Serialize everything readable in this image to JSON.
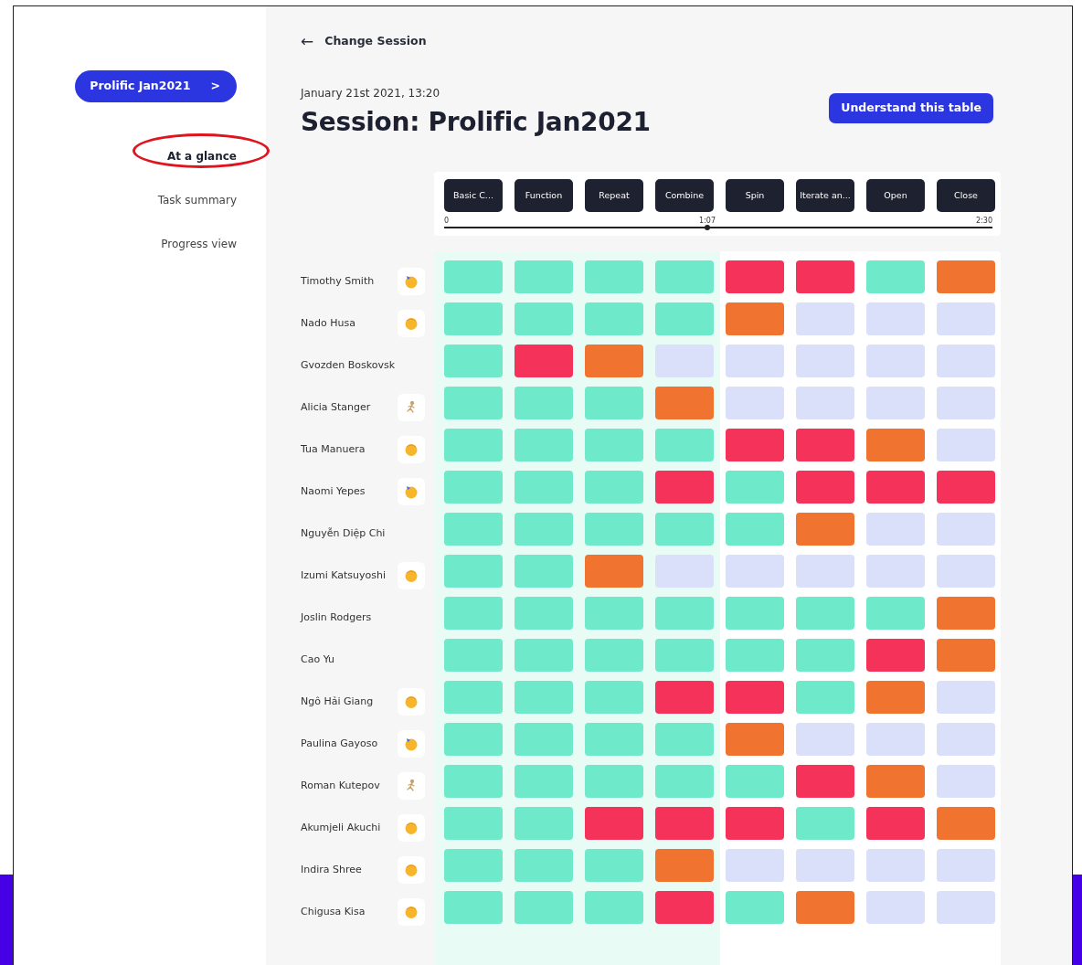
{
  "session_button": {
    "label": "Prolific Jan2021",
    "chevron": ">"
  },
  "sidebar": {
    "items": [
      {
        "label": "At a glance",
        "selected": true,
        "circled": true
      },
      {
        "label": "Task summary",
        "selected": false,
        "circled": false
      },
      {
        "label": "Progress view",
        "selected": false,
        "circled": false
      }
    ]
  },
  "back_link": {
    "arrow": "←",
    "label": "Change Session"
  },
  "date": "January 21st 2021, 13:20",
  "title": "Session: Prolific Jan2021",
  "help_button": "Understand this table",
  "tasks": [
    {
      "label": "Basic C...",
      "highlighted": true
    },
    {
      "label": "Function",
      "highlighted": true
    },
    {
      "label": "Repeat",
      "highlighted": true
    },
    {
      "label": "Combine",
      "highlighted": true
    },
    {
      "label": "Spin",
      "highlighted": false
    },
    {
      "label": "Iterate an...",
      "highlighted": false
    },
    {
      "label": "Open",
      "highlighted": false
    },
    {
      "label": "Close",
      "highlighted": false
    }
  ],
  "timeline": {
    "start": "0",
    "marker": "1:07",
    "end": "2:30",
    "level": 0.48
  },
  "students": [
    {
      "name": "Timothy Smith",
      "kind": "party",
      "results": [
        {
          "color": "#6ee9c9"
        },
        {
          "color": "#6ee9c9"
        },
        {
          "color": "#6ee9c9"
        },
        {
          "color": "#6ee9c9"
        },
        {
          "color": "#f5335a"
        },
        {
          "color": "#f5335a"
        },
        {
          "color": "#6ee9c9"
        },
        {
          "color": "#f0742f"
        }
      ]
    },
    {
      "name": "Nado Husa",
      "kind": "sleepy",
      "results": [
        {
          "color": "#6ee9c9"
        },
        {
          "color": "#6ee9c9"
        },
        {
          "color": "#6ee9c9"
        },
        {
          "color": "#6ee9c9"
        },
        {
          "color": "#f0742f"
        },
        {
          "color": "#dadffa"
        },
        {
          "color": "#dadffa"
        },
        {
          "color": "#dadffa"
        }
      ]
    },
    {
      "name": "Gvozden Boskovsk",
      "kind": "plain",
      "results": [
        {
          "color": "#6ee9c9"
        },
        {
          "color": "#f5335a"
        },
        {
          "color": "#f0742f"
        },
        {
          "color": "#dadffa"
        },
        {
          "color": "#dadffa"
        },
        {
          "color": "#dadffa"
        },
        {
          "color": "#dadffa"
        },
        {
          "color": "#dadffa"
        }
      ]
    },
    {
      "name": "Alicia Stanger",
      "kind": "runner",
      "results": [
        {
          "color": "#6ee9c9"
        },
        {
          "color": "#6ee9c9"
        },
        {
          "color": "#6ee9c9"
        },
        {
          "color": "#f0742f"
        },
        {
          "color": "#dadffa"
        },
        {
          "color": "#dadffa"
        },
        {
          "color": "#dadffa"
        },
        {
          "color": "#dadffa"
        }
      ]
    },
    {
      "name": "Tua Manuera",
      "kind": "sleepy",
      "results": [
        {
          "color": "#6ee9c9"
        },
        {
          "color": "#6ee9c9"
        },
        {
          "color": "#6ee9c9"
        },
        {
          "color": "#6ee9c9"
        },
        {
          "color": "#f5335a"
        },
        {
          "color": "#f5335a"
        },
        {
          "color": "#f0742f"
        },
        {
          "color": "#dadffa"
        }
      ]
    },
    {
      "name": "Naomi Yepes",
      "kind": "party",
      "results": [
        {
          "color": "#6ee9c9"
        },
        {
          "color": "#6ee9c9"
        },
        {
          "color": "#6ee9c9"
        },
        {
          "color": "#f5335a"
        },
        {
          "color": "#6ee9c9"
        },
        {
          "color": "#f5335a"
        },
        {
          "color": "#f5335a"
        },
        {
          "color": "#f5335a"
        }
      ]
    },
    {
      "name": "Nguyễn Diệp Chi",
      "kind": "plain",
      "results": [
        {
          "color": "#6ee9c9"
        },
        {
          "color": "#6ee9c9"
        },
        {
          "color": "#6ee9c9"
        },
        {
          "color": "#6ee9c9"
        },
        {
          "color": "#6ee9c9"
        },
        {
          "color": "#f0742f"
        },
        {
          "color": "#dadffa"
        },
        {
          "color": "#dadffa"
        }
      ]
    },
    {
      "name": "Izumi Katsuyoshi",
      "kind": "sleepy",
      "results": [
        {
          "color": "#6ee9c9"
        },
        {
          "color": "#6ee9c9"
        },
        {
          "color": "#f0742f"
        },
        {
          "color": "#dadffa"
        },
        {
          "color": "#dadffa"
        },
        {
          "color": "#dadffa"
        },
        {
          "color": "#dadffa"
        },
        {
          "color": "#dadffa"
        }
      ]
    },
    {
      "name": "Joslin Rodgers",
      "kind": "plain",
      "results": [
        {
          "color": "#6ee9c9"
        },
        {
          "color": "#6ee9c9"
        },
        {
          "color": "#6ee9c9"
        },
        {
          "color": "#6ee9c9"
        },
        {
          "color": "#6ee9c9"
        },
        {
          "color": "#6ee9c9"
        },
        {
          "color": "#6ee9c9"
        },
        {
          "color": "#f0742f"
        }
      ]
    },
    {
      "name": "Cao Yu",
      "kind": "plain",
      "results": [
        {
          "color": "#6ee9c9"
        },
        {
          "color": "#6ee9c9"
        },
        {
          "color": "#6ee9c9"
        },
        {
          "color": "#6ee9c9"
        },
        {
          "color": "#6ee9c9"
        },
        {
          "color": "#6ee9c9"
        },
        {
          "color": "#f5335a"
        },
        {
          "color": "#f0742f"
        }
      ]
    },
    {
      "name": "Ngô Hải Giang",
      "kind": "sleepy",
      "results": [
        {
          "color": "#6ee9c9"
        },
        {
          "color": "#6ee9c9"
        },
        {
          "color": "#6ee9c9"
        },
        {
          "color": "#f5335a"
        },
        {
          "color": "#f5335a"
        },
        {
          "color": "#6ee9c9"
        },
        {
          "color": "#f0742f"
        },
        {
          "color": "#dadffa"
        }
      ]
    },
    {
      "name": "Paulina Gayoso",
      "kind": "party",
      "results": [
        {
          "color": "#6ee9c9"
        },
        {
          "color": "#6ee9c9"
        },
        {
          "color": "#6ee9c9"
        },
        {
          "color": "#6ee9c9"
        },
        {
          "color": "#f0742f"
        },
        {
          "color": "#dadffa"
        },
        {
          "color": "#dadffa"
        },
        {
          "color": "#dadffa"
        }
      ]
    },
    {
      "name": "Roman Kutepov",
      "kind": "runner",
      "results": [
        {
          "color": "#6ee9c9"
        },
        {
          "color": "#6ee9c9"
        },
        {
          "color": "#6ee9c9"
        },
        {
          "color": "#6ee9c9"
        },
        {
          "color": "#6ee9c9"
        },
        {
          "color": "#f5335a"
        },
        {
          "color": "#f0742f"
        },
        {
          "color": "#dadffa"
        }
      ]
    },
    {
      "name": "Akumjeli Akuchi",
      "kind": "sleepy",
      "results": [
        {
          "color": "#6ee9c9"
        },
        {
          "color": "#6ee9c9"
        },
        {
          "color": "#f5335a"
        },
        {
          "color": "#f5335a"
        },
        {
          "color": "#f5335a"
        },
        {
          "color": "#6ee9c9"
        },
        {
          "color": "#f5335a"
        },
        {
          "color": "#f0742f"
        }
      ]
    },
    {
      "name": "Indira Shree",
      "kind": "sleepy",
      "results": [
        {
          "color": "#6ee9c9"
        },
        {
          "color": "#6ee9c9"
        },
        {
          "color": "#6ee9c9"
        },
        {
          "color": "#f0742f"
        },
        {
          "color": "#dadffa"
        },
        {
          "color": "#dadffa"
        },
        {
          "color": "#dadffa"
        },
        {
          "color": "#dadffa"
        }
      ]
    },
    {
      "name": "Chigusa Kisa",
      "kind": "sleepy",
      "results": [
        {
          "color": "#6ee9c9"
        },
        {
          "color": "#6ee9c9"
        },
        {
          "color": "#6ee9c9"
        },
        {
          "color": "#f5335a"
        },
        {
          "color": "#6ee9c9"
        },
        {
          "color": "#f0742f"
        },
        {
          "color": "#dadffa"
        },
        {
          "color": "#dadffa"
        }
      ]
    }
  ]
}
